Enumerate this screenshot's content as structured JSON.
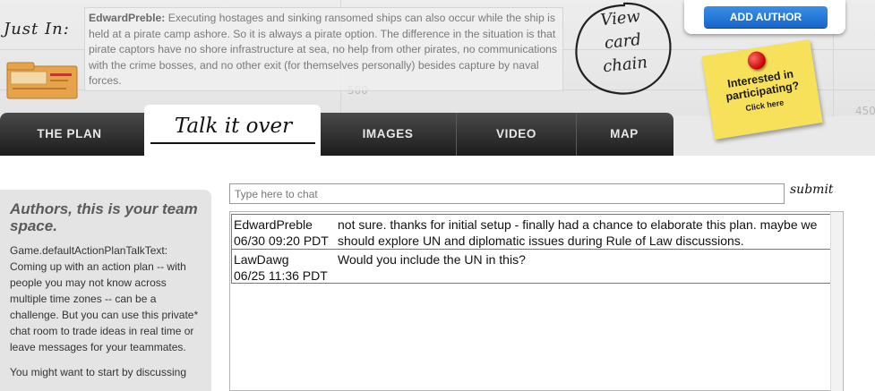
{
  "header": {
    "just_in_label": "Just In:",
    "news": {
      "author": "EdwardPreble:",
      "text": "Executing hostages and sinking ransomed ships can also occur while the ship is held at a pirate camp ashore. So it is always a pirate option. The difference in the situation is that pirate captors have no shore infrastructure at sea, no help from other pirates, no communications with the crime bosses, and no other exit (for themselves personally) besides capture by naval forces."
    },
    "view_chain": [
      "View",
      "card",
      "chain"
    ],
    "add_author_label": "ADD AUTHOR",
    "sticky": {
      "line1": "Interested in",
      "line2": "participating?",
      "sub": "Click here"
    },
    "map_numbers": [
      "500",
      "450"
    ]
  },
  "tabs": [
    {
      "label": "THE PLAN",
      "active": false
    },
    {
      "label": "Talk it over",
      "active": true
    },
    {
      "label": "IMAGES",
      "active": false
    },
    {
      "label": "VIDEO",
      "active": false
    },
    {
      "label": "MAP",
      "active": false
    }
  ],
  "sidebar": {
    "title": "Authors, this is your team space.",
    "body": "Game.defaultActionPlanTalkText: Coming up with an action plan -- with people you may not know across multiple time zones -- can be a challenge. But you can use this private* chat room to trade ideas in real time or leave messages for your teammates.",
    "more": "You might want to start by discussing"
  },
  "chat": {
    "placeholder": "Type here to chat",
    "submit_label": "submit",
    "messages": [
      {
        "user": "EdwardPreble",
        "time": "06/30 09:20 PDT",
        "text": "not sure. thanks for initial setup - finally had a chance to elaborate this plan. maybe we should explore UN and diplomatic issues during Rule of Law discussions."
      },
      {
        "user": "LawDawg",
        "time": "06/25 11:36 PDT",
        "text": "Would you include the UN in this?"
      }
    ]
  },
  "colors": {
    "accent_blue": "#1765c9",
    "tab_dark": "#1c1c1c",
    "sticky_yellow": "#f7e05a",
    "pin_red": "#c40000"
  }
}
